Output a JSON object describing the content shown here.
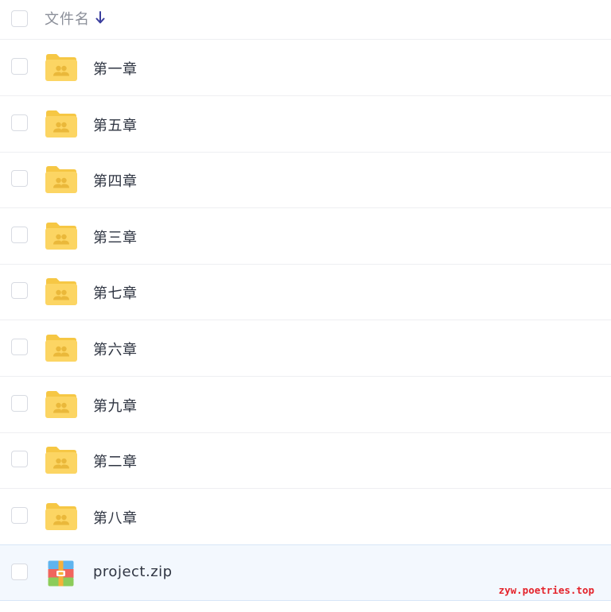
{
  "header": {
    "column_label": "文件名",
    "sort_direction": "descending",
    "icon": "arrow-down-icon"
  },
  "files": [
    {
      "name": "第一章",
      "type": "shared-folder",
      "icon": "shared-folder-icon"
    },
    {
      "name": "第五章",
      "type": "shared-folder",
      "icon": "shared-folder-icon"
    },
    {
      "name": "第四章",
      "type": "shared-folder",
      "icon": "shared-folder-icon"
    },
    {
      "name": "第三章",
      "type": "shared-folder",
      "icon": "shared-folder-icon"
    },
    {
      "name": "第七章",
      "type": "shared-folder",
      "icon": "shared-folder-icon"
    },
    {
      "name": "第六章",
      "type": "shared-folder",
      "icon": "shared-folder-icon"
    },
    {
      "name": "第九章",
      "type": "shared-folder",
      "icon": "shared-folder-icon"
    },
    {
      "name": "第二章",
      "type": "shared-folder",
      "icon": "shared-folder-icon"
    },
    {
      "name": "第八章",
      "type": "shared-folder",
      "icon": "shared-folder-icon"
    },
    {
      "name": "project.zip",
      "type": "zip-archive",
      "icon": "zip-archive-icon"
    }
  ],
  "watermark": "zyw.poetries.top",
  "colors": {
    "folder": "#fcd563",
    "folder_tab": "#f6c744",
    "sort_arrow": "#3b3f9e",
    "selected_row_bg": "#f3f8fe",
    "watermark": "#e4222a"
  }
}
